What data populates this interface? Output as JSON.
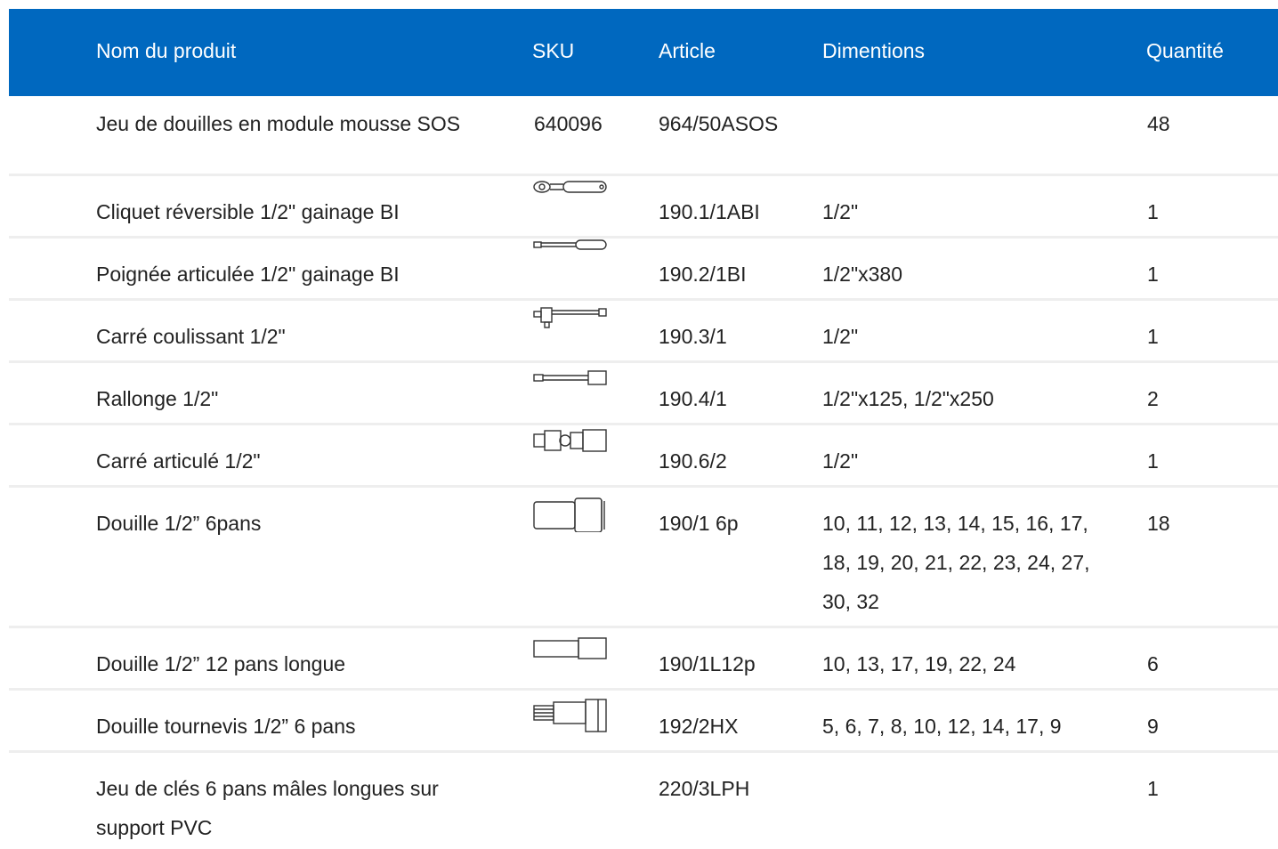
{
  "table": {
    "headers": {
      "name": "Nom du produit",
      "sku": "SKU",
      "article": "Article",
      "dimensions": "Dimentions",
      "quantity": "Quantité"
    },
    "rows": [
      {
        "name": "Jeu de douilles en module mousse SOS",
        "sku": "640096",
        "article": "964/50ASOS",
        "dimensions": "",
        "quantity": "48",
        "icon": ""
      },
      {
        "name": "Cliquet réversible 1/2\" gainage BI",
        "sku": "",
        "article": "190.1/1ABI",
        "dimensions": "1/2\"",
        "quantity": "1",
        "icon": "ratchet-icon"
      },
      {
        "name": "Poignée articulée 1/2\" gainage BI",
        "sku": "",
        "article": "190.2/1BI",
        "dimensions": "1/2\"x380",
        "quantity": "1",
        "icon": "breaker-bar-icon"
      },
      {
        "name": "Carré coulissant 1/2\"",
        "sku": "",
        "article": "190.3/1",
        "dimensions": "1/2\"",
        "quantity": "1",
        "icon": "sliding-t-bar-icon"
      },
      {
        "name": "Rallonge 1/2\"",
        "sku": "",
        "article": "190.4/1",
        "dimensions": "1/2\"x125, 1/2\"x250",
        "quantity": "2",
        "icon": "extension-bar-icon"
      },
      {
        "name": "Carré articulé 1/2\"",
        "sku": "",
        "article": "190.6/2",
        "dimensions": "1/2\"",
        "quantity": "1",
        "icon": "universal-joint-icon"
      },
      {
        "name": "Douille 1/2” 6pans",
        "sku": "",
        "article": "190/1 6p",
        "dimensions": "10, 11, 12, 13, 14, 15, 16, 17, 18, 19, 20, 21, 22, 23, 24, 27, 30, 32",
        "quantity": "18",
        "icon": "socket-icon"
      },
      {
        "name": "Douille 1/2” 12 pans longue",
        "sku": "",
        "article": "190/1L12p",
        "dimensions": "10, 13, 17, 19, 22, 24",
        "quantity": "6",
        "icon": "deep-socket-icon"
      },
      {
        "name": "Douille tournevis 1/2” 6 pans",
        "sku": "",
        "article": "192/2HX",
        "dimensions": "5, 6, 7, 8, 10, 12, 14, 17, 9",
        "quantity": "9",
        "icon": "hex-bit-socket-icon"
      },
      {
        "name": "Jeu de clés 6 pans mâles longues sur support PVC",
        "sku": "",
        "article": "220/3LPH",
        "dimensions": "",
        "quantity": "1",
        "icon": ""
      }
    ]
  },
  "colors": {
    "header_bg": "#0068bf",
    "header_text": "#ffffff",
    "row_divider": "#eeeeee"
  }
}
